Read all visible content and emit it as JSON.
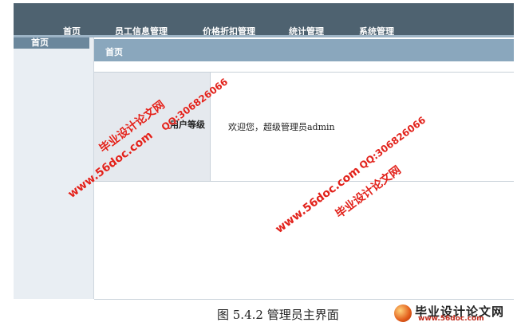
{
  "nav": {
    "items": [
      "首页",
      "员工信息管理",
      "价格折扣管理",
      "统计管理",
      "系统管理"
    ]
  },
  "sidebar": {
    "active": "首页"
  },
  "main": {
    "title": "首页",
    "label": "用户等级",
    "welcome": "欢迎您，超级管理员admin"
  },
  "caption": "图 5.4.2 管理员主界面",
  "watermarks": {
    "site_name": "毕业设计论文网",
    "url": "www.56doc.com",
    "qq": "QQ:306826066"
  },
  "logo": {
    "name": "毕业设计论文网",
    "url": "www.56doc.com"
  },
  "colors": {
    "topbar": "#4e6270",
    "sidebar_active": "#6b879c",
    "header": "#8aa7bd",
    "watermark": "#e2221b"
  }
}
